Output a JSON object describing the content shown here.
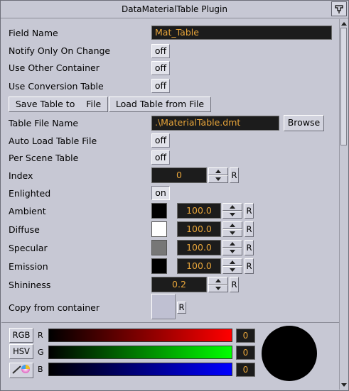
{
  "window": {
    "title": "DataMaterialTable Plugin",
    "corner_icon": "pin-icon"
  },
  "fields": {
    "field_name": {
      "label": "Field Name",
      "value": "Mat_Table"
    },
    "notify_only_on_change": {
      "label": "Notify Only On Change",
      "value": "off"
    },
    "use_other_container": {
      "label": "Use Other Container",
      "value": "off"
    },
    "use_conversion_table": {
      "label": "Use Conversion Table",
      "value": "off"
    },
    "save_table_button": "Save Table to    File",
    "load_table_button": "Load Table from File",
    "table_file_name": {
      "label": "Table File Name",
      "value": ".\\MaterialTable.dmt",
      "browse": "Browse"
    },
    "auto_load_table_file": {
      "label": "Auto Load Table File",
      "value": "off"
    },
    "per_scene_table": {
      "label": "Per Scene Table",
      "value": "off"
    },
    "index": {
      "label": "Index",
      "value": "0",
      "reset": "R"
    },
    "enlighted": {
      "label": "Enlighted",
      "value": "on"
    },
    "ambient": {
      "label": "Ambient",
      "value": "100.0",
      "color": "#000000",
      "reset": "R"
    },
    "diffuse": {
      "label": "Diffuse",
      "value": "100.0",
      "color": "#ffffff",
      "reset": "R"
    },
    "specular": {
      "label": "Specular",
      "value": "100.0",
      "color": "#777777",
      "reset": "R"
    },
    "emission": {
      "label": "Emission",
      "value": "100.0",
      "color": "#000000",
      "reset": "R"
    },
    "shininess": {
      "label": "Shininess",
      "value": "0.2",
      "reset": "R"
    },
    "copy_from_container": {
      "label": "Copy from container",
      "reset": "R"
    }
  },
  "color_editor": {
    "modes": [
      "RGB",
      "HSV"
    ],
    "picker_icon": "color-picker-icon",
    "channels": [
      {
        "label": "R",
        "value": "0",
        "gradient_end": "#ff0000"
      },
      {
        "label": "G",
        "value": "0",
        "gradient_end": "#00ff00"
      },
      {
        "label": "B",
        "value": "0",
        "gradient_end": "#0000ff"
      }
    ],
    "preview_color": "#000000"
  }
}
